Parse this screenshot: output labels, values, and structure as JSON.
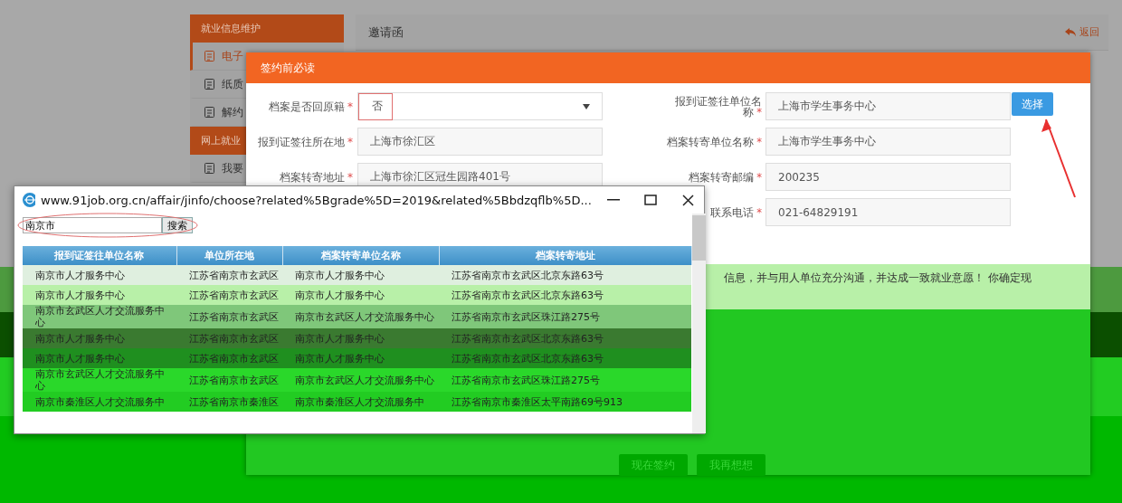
{
  "sidebar": {
    "groups": [
      {
        "title": "就业信息维护",
        "items": [
          {
            "label": "电子",
            "selected": true
          },
          {
            "label": "纸质",
            "selected": false
          },
          {
            "label": "解约",
            "selected": false
          }
        ]
      },
      {
        "title": "网上就业",
        "items": [
          {
            "label": "我要",
            "selected": false
          }
        ]
      }
    ]
  },
  "main_panel": {
    "title": "邀请函",
    "back_link": "返回"
  },
  "modal": {
    "title": "签约前必读",
    "left_fields": [
      {
        "label": "档案是否回原籍",
        "required_mark": "*",
        "kind": "select",
        "value": "否"
      },
      {
        "label": "报到证签往所在地",
        "required_mark": "*",
        "kind": "text",
        "value": "上海市徐汇区"
      },
      {
        "label": "档案转寄地址",
        "required_mark": "*",
        "kind": "text",
        "value": "上海市徐汇区冠生园路401号"
      }
    ],
    "right_fields": [
      {
        "label": "报到证签往单位名",
        "label_tail": "称",
        "required_mark": "*",
        "kind": "text",
        "value": "上海市学生事务中心",
        "button": "选择"
      },
      {
        "label": "档案转寄单位名称",
        "required_mark": "*",
        "kind": "text",
        "value": "上海市学生事务中心"
      },
      {
        "label": "档案转寄邮编",
        "required_mark": "*",
        "kind": "text",
        "value": "200235"
      },
      {
        "label": "联系电话",
        "required_mark": "*",
        "kind": "text",
        "value": "021-64829191"
      }
    ],
    "message": "信息，并与用人单位充分沟通，并达成一致就业意愿！ 你确定现",
    "buttons": [
      "现在签约",
      "我再想想"
    ]
  },
  "popup": {
    "url": "www.91job.org.cn/affair/jinfo/choose?related%5Bgrade%5D=2019&related%5Bbdzqflb%5D...",
    "search_value": "南京市",
    "search_button": "搜索",
    "columns": [
      "报到证签往单位名称",
      "单位所在地",
      "档案转寄单位名称",
      "档案转寄地址"
    ],
    "rows": [
      [
        "南京市人才服务中心",
        "江苏省南京市玄武区",
        "南京市人才服务中心",
        "江苏省南京市玄武区北京东路63号"
      ],
      [
        "南京市人才服务中心",
        "江苏省南京市玄武区",
        "南京市人才服务中心",
        "江苏省南京市玄武区北京东路63号"
      ],
      [
        "南京市玄武区人才交流服务中心",
        "江苏省南京市玄武区",
        "南京市玄武区人才交流服务中心",
        "江苏省南京市玄武区珠江路275号"
      ],
      [
        "南京市人才服务中心",
        "江苏省南京市玄武区",
        "南京市人才服务中心",
        "江苏省南京市玄武区北京东路63号"
      ],
      [
        "南京市人才服务中心",
        "江苏省南京市玄武区",
        "南京市人才服务中心",
        "江苏省南京市玄武区北京东路63号"
      ],
      [
        "南京市玄武区人才交流服务中心",
        "江苏省南京市玄武区",
        "南京市玄武区人才交流服务中心",
        "江苏省南京市玄武区珠江路275号"
      ],
      [
        "南京市秦淮区人才交流服务中",
        "江苏省南京市秦淮区",
        "南京市秦淮区人才交流服务中",
        "江苏省南京市秦淮区太平南路69号913"
      ]
    ]
  }
}
